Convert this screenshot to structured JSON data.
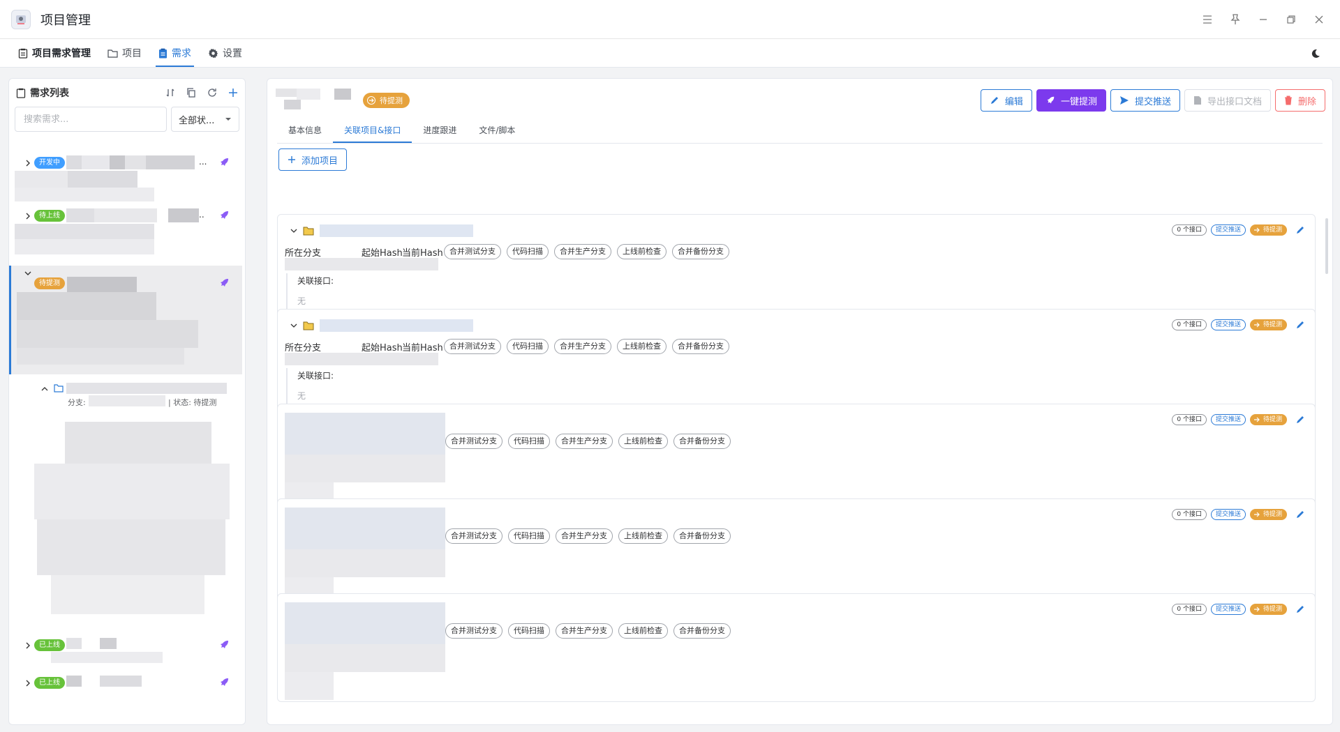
{
  "app": {
    "title": "项目管理"
  },
  "nav": {
    "brand": "项目需求管理",
    "items": [
      {
        "label": "项目",
        "active": false
      },
      {
        "label": "需求",
        "active": true
      },
      {
        "label": "设置",
        "active": false
      }
    ]
  },
  "left_panel": {
    "title": "需求列表",
    "search_placeholder": "搜索需求...",
    "status_filter": "全部状...",
    "items": [
      {
        "status": "开发中",
        "color": "#409eff",
        "ellipsis": "..."
      },
      {
        "status": "待上线",
        "color": "#67c23a",
        "ellipsis": ".."
      },
      {
        "status": "待提测",
        "color": "#e6a23c"
      },
      {
        "status": "已上线",
        "color": "#67c23a"
      },
      {
        "status": "已上线",
        "color": "#67c23a"
      }
    ],
    "sub_project": {
      "branch_label": "分支:",
      "status_text": "| 状态: 待提测"
    }
  },
  "detail": {
    "status": "待提测",
    "actions": {
      "edit": "编辑",
      "one_click": "一键提测",
      "submit_push": "提交推送",
      "export_docs": "导出接口文档",
      "delete": "删除"
    },
    "tabs": [
      "基本信息",
      "关联项目&接口",
      "进度跟进",
      "文件/脚本"
    ],
    "add_project": "添加项目",
    "card_labels": {
      "branch": "所在分支",
      "start_hash": "起始Hash",
      "current_hash": "当前Hash",
      "interfaces_label": "关联接口:",
      "interfaces_empty": "无",
      "iface_count": "0 个接口",
      "push_tag": "提交推送",
      "status_tag": "待提测"
    },
    "chips": [
      "合并测试分支",
      "代码扫描",
      "合并生产分支",
      "上线前检查",
      "合并备份分支"
    ]
  },
  "colors": {
    "accent": "#2b7ad6",
    "purple": "#7c3aed",
    "warning": "#e6a23c",
    "danger": "#f56c6c",
    "success": "#67c23a"
  }
}
